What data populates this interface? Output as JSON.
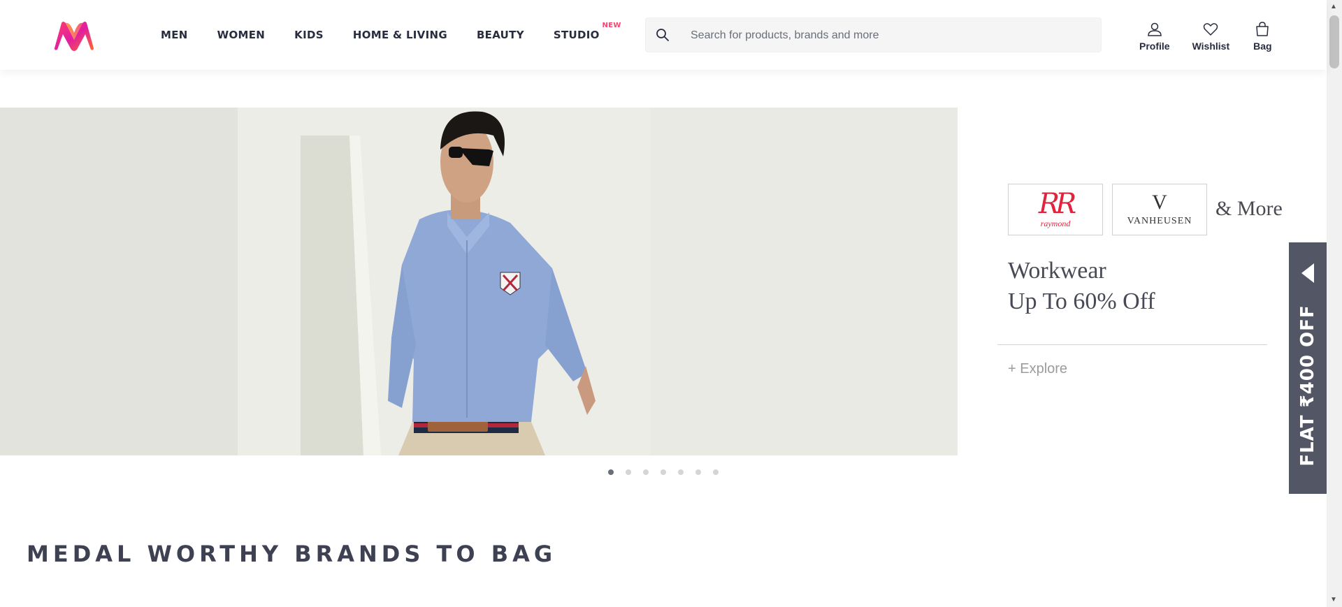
{
  "header": {
    "logo_icon": "myntra-logo-icon",
    "nav": [
      {
        "label": "MEN"
      },
      {
        "label": "WOMEN"
      },
      {
        "label": "KIDS"
      },
      {
        "label": "HOME & LIVING"
      },
      {
        "label": "BEAUTY"
      },
      {
        "label": "STUDIO",
        "badge": "NEW"
      }
    ],
    "search": {
      "placeholder": "Search for products, brands and more",
      "value": ""
    },
    "actions": [
      {
        "label": "Profile",
        "icon": "user-icon"
      },
      {
        "label": "Wishlist",
        "icon": "heart-icon"
      },
      {
        "label": "Bag",
        "icon": "bag-icon"
      }
    ]
  },
  "banner": {
    "brands": [
      {
        "monogram": "RR",
        "name": "raymond",
        "color": "#e0243d"
      },
      {
        "monogram": "V",
        "name": "VANHEUSEN",
        "color": "#333333"
      }
    ],
    "and_more": "& More",
    "offer_line1": "Workwear",
    "offer_line2": "Up To 60% Off",
    "cta": "+ Explore",
    "slides_count": 7,
    "active_slide": 1
  },
  "side_tab": {
    "text": "FLAT ₹400 OFF",
    "arrow_icon": "caret-left-icon",
    "color": "#535665"
  },
  "section": {
    "title": "MEDAL WORTHY BRANDS TO BAG"
  },
  "colors": {
    "brand_pink": "#ff3f6c",
    "text_dark": "#282c3f"
  }
}
